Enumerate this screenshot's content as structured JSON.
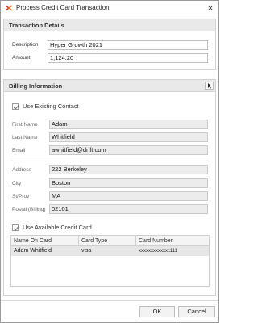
{
  "window": {
    "title": "Process Credit Card Transaction",
    "close_label": "×"
  },
  "transaction_details": {
    "header": "Transaction Details",
    "description_label": "Description",
    "description_value": "Hyper Growth 2021",
    "amount_label": "Amount",
    "amount_value": "1,124.20"
  },
  "billing": {
    "header": "Billing Information",
    "use_existing_contact_label": "Use Existing Contact",
    "use_existing_contact_checked": true,
    "first_name_label": "First Name",
    "first_name_value": "Adam",
    "last_name_label": "Last Name",
    "last_name_value": "Whitfield",
    "email_label": "Email",
    "email_value": "awhitfield@drift.com",
    "address_label": "Address",
    "address_value": "222 Berkeley",
    "city_label": "City",
    "city_value": "Boston",
    "state_label": "St/Prov",
    "state_value": "MA",
    "postal_label": "Postal (Billing)",
    "postal_value": "02101",
    "use_available_card_label": "Use Available Credit Card",
    "use_available_card_checked": true
  },
  "card_table": {
    "columns": [
      "Name On Card",
      "Card Type",
      "Card Number"
    ],
    "rows": [
      [
        "Adam Whitfield",
        "visa",
        "xxxxxxxxxxxx1111"
      ]
    ]
  },
  "footer": {
    "ok_label": "OK",
    "cancel_label": "Cancel"
  },
  "colors": {
    "app_icon": "#d9342b",
    "checkmark": "#666666"
  }
}
